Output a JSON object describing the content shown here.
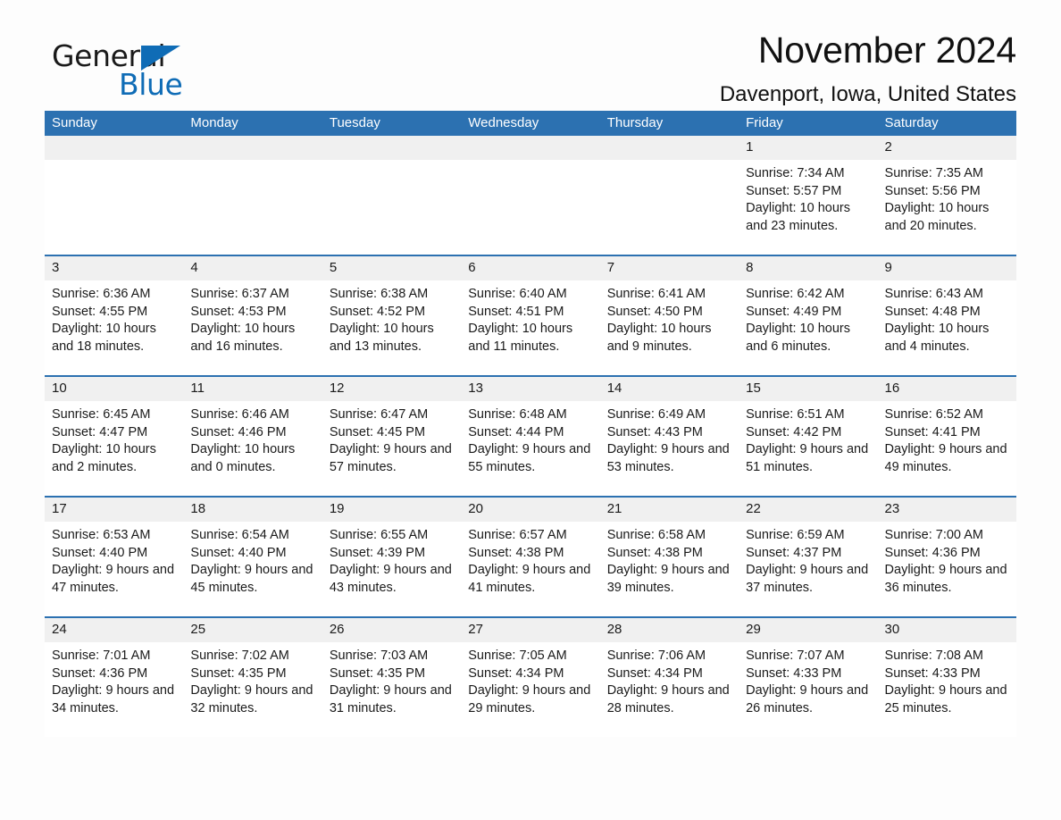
{
  "logo": {
    "text_primary": "General",
    "text_secondary": "Blue",
    "triangle_color": "#0f6cb6"
  },
  "header": {
    "title": "November 2024",
    "subtitle": "Davenport, Iowa, United States"
  },
  "colors": {
    "header_blue": "#2c71b1",
    "day_band_gray": "#f0f0f0",
    "cell_white": "#ffffff",
    "text": "#1a1a1a",
    "logo_blue": "#0f6cb6"
  },
  "weekdays": [
    "Sunday",
    "Monday",
    "Tuesday",
    "Wednesday",
    "Thursday",
    "Friday",
    "Saturday"
  ],
  "weeks": [
    [
      {
        "day": "",
        "empty": true
      },
      {
        "day": "",
        "empty": true
      },
      {
        "day": "",
        "empty": true
      },
      {
        "day": "",
        "empty": true
      },
      {
        "day": "",
        "empty": true
      },
      {
        "day": "1",
        "sunrise": "Sunrise: 7:34 AM",
        "sunset": "Sunset: 5:57 PM",
        "daylight": "Daylight: 10 hours and 23 minutes."
      },
      {
        "day": "2",
        "sunrise": "Sunrise: 7:35 AM",
        "sunset": "Sunset: 5:56 PM",
        "daylight": "Daylight: 10 hours and 20 minutes."
      }
    ],
    [
      {
        "day": "3",
        "sunrise": "Sunrise: 6:36 AM",
        "sunset": "Sunset: 4:55 PM",
        "daylight": "Daylight: 10 hours and 18 minutes."
      },
      {
        "day": "4",
        "sunrise": "Sunrise: 6:37 AM",
        "sunset": "Sunset: 4:53 PM",
        "daylight": "Daylight: 10 hours and 16 minutes."
      },
      {
        "day": "5",
        "sunrise": "Sunrise: 6:38 AM",
        "sunset": "Sunset: 4:52 PM",
        "daylight": "Daylight: 10 hours and 13 minutes."
      },
      {
        "day": "6",
        "sunrise": "Sunrise: 6:40 AM",
        "sunset": "Sunset: 4:51 PM",
        "daylight": "Daylight: 10 hours and 11 minutes."
      },
      {
        "day": "7",
        "sunrise": "Sunrise: 6:41 AM",
        "sunset": "Sunset: 4:50 PM",
        "daylight": "Daylight: 10 hours and 9 minutes."
      },
      {
        "day": "8",
        "sunrise": "Sunrise: 6:42 AM",
        "sunset": "Sunset: 4:49 PM",
        "daylight": "Daylight: 10 hours and 6 minutes."
      },
      {
        "day": "9",
        "sunrise": "Sunrise: 6:43 AM",
        "sunset": "Sunset: 4:48 PM",
        "daylight": "Daylight: 10 hours and 4 minutes."
      }
    ],
    [
      {
        "day": "10",
        "sunrise": "Sunrise: 6:45 AM",
        "sunset": "Sunset: 4:47 PM",
        "daylight": "Daylight: 10 hours and 2 minutes."
      },
      {
        "day": "11",
        "sunrise": "Sunrise: 6:46 AM",
        "sunset": "Sunset: 4:46 PM",
        "daylight": "Daylight: 10 hours and 0 minutes."
      },
      {
        "day": "12",
        "sunrise": "Sunrise: 6:47 AM",
        "sunset": "Sunset: 4:45 PM",
        "daylight": "Daylight: 9 hours and 57 minutes."
      },
      {
        "day": "13",
        "sunrise": "Sunrise: 6:48 AM",
        "sunset": "Sunset: 4:44 PM",
        "daylight": "Daylight: 9 hours and 55 minutes."
      },
      {
        "day": "14",
        "sunrise": "Sunrise: 6:49 AM",
        "sunset": "Sunset: 4:43 PM",
        "daylight": "Daylight: 9 hours and 53 minutes."
      },
      {
        "day": "15",
        "sunrise": "Sunrise: 6:51 AM",
        "sunset": "Sunset: 4:42 PM",
        "daylight": "Daylight: 9 hours and 51 minutes."
      },
      {
        "day": "16",
        "sunrise": "Sunrise: 6:52 AM",
        "sunset": "Sunset: 4:41 PM",
        "daylight": "Daylight: 9 hours and 49 minutes."
      }
    ],
    [
      {
        "day": "17",
        "sunrise": "Sunrise: 6:53 AM",
        "sunset": "Sunset: 4:40 PM",
        "daylight": "Daylight: 9 hours and 47 minutes."
      },
      {
        "day": "18",
        "sunrise": "Sunrise: 6:54 AM",
        "sunset": "Sunset: 4:40 PM",
        "daylight": "Daylight: 9 hours and 45 minutes."
      },
      {
        "day": "19",
        "sunrise": "Sunrise: 6:55 AM",
        "sunset": "Sunset: 4:39 PM",
        "daylight": "Daylight: 9 hours and 43 minutes."
      },
      {
        "day": "20",
        "sunrise": "Sunrise: 6:57 AM",
        "sunset": "Sunset: 4:38 PM",
        "daylight": "Daylight: 9 hours and 41 minutes."
      },
      {
        "day": "21",
        "sunrise": "Sunrise: 6:58 AM",
        "sunset": "Sunset: 4:38 PM",
        "daylight": "Daylight: 9 hours and 39 minutes."
      },
      {
        "day": "22",
        "sunrise": "Sunrise: 6:59 AM",
        "sunset": "Sunset: 4:37 PM",
        "daylight": "Daylight: 9 hours and 37 minutes."
      },
      {
        "day": "23",
        "sunrise": "Sunrise: 7:00 AM",
        "sunset": "Sunset: 4:36 PM",
        "daylight": "Daylight: 9 hours and 36 minutes."
      }
    ],
    [
      {
        "day": "24",
        "sunrise": "Sunrise: 7:01 AM",
        "sunset": "Sunset: 4:36 PM",
        "daylight": "Daylight: 9 hours and 34 minutes."
      },
      {
        "day": "25",
        "sunrise": "Sunrise: 7:02 AM",
        "sunset": "Sunset: 4:35 PM",
        "daylight": "Daylight: 9 hours and 32 minutes."
      },
      {
        "day": "26",
        "sunrise": "Sunrise: 7:03 AM",
        "sunset": "Sunset: 4:35 PM",
        "daylight": "Daylight: 9 hours and 31 minutes."
      },
      {
        "day": "27",
        "sunrise": "Sunrise: 7:05 AM",
        "sunset": "Sunset: 4:34 PM",
        "daylight": "Daylight: 9 hours and 29 minutes."
      },
      {
        "day": "28",
        "sunrise": "Sunrise: 7:06 AM",
        "sunset": "Sunset: 4:34 PM",
        "daylight": "Daylight: 9 hours and 28 minutes."
      },
      {
        "day": "29",
        "sunrise": "Sunrise: 7:07 AM",
        "sunset": "Sunset: 4:33 PM",
        "daylight": "Daylight: 9 hours and 26 minutes."
      },
      {
        "day": "30",
        "sunrise": "Sunrise: 7:08 AM",
        "sunset": "Sunset: 4:33 PM",
        "daylight": "Daylight: 9 hours and 25 minutes."
      }
    ]
  ]
}
